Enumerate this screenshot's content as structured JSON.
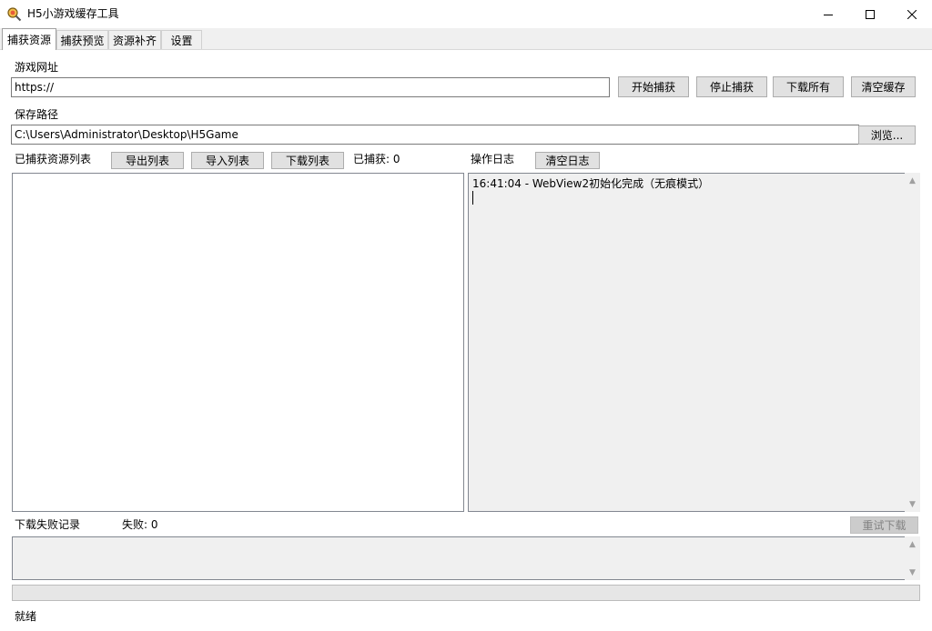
{
  "window": {
    "title": "H5小游戏缓存工具"
  },
  "tabs": [
    {
      "label": "捕获资源",
      "active": true
    },
    {
      "label": "捕获预览"
    },
    {
      "label": "资源补齐"
    },
    {
      "label": "设置"
    }
  ],
  "url_section": {
    "label": "游戏网址",
    "value": "https://",
    "buttons": {
      "start": "开始捕获",
      "stop": "停止捕获",
      "download_all": "下载所有",
      "clear_cache": "清空缓存"
    }
  },
  "path_section": {
    "label": "保存路径",
    "value": "C:\\Users\\Administrator\\Desktop\\H5Game",
    "browse": "浏览..."
  },
  "resources": {
    "label": "已捕获资源列表",
    "export": "导出列表",
    "import": "导入列表",
    "download": "下载列表",
    "count": "已捕获: 0"
  },
  "log": {
    "label": "操作日志",
    "clear": "清空日志",
    "lines": [
      "16:41:04 - WebView2初始化完成（无痕模式）"
    ]
  },
  "failures": {
    "label": "下载失败记录",
    "count": "失败: 0",
    "retry": "重试下载"
  },
  "status": {
    "text": "就绪"
  },
  "progress": {
    "value": 0
  }
}
